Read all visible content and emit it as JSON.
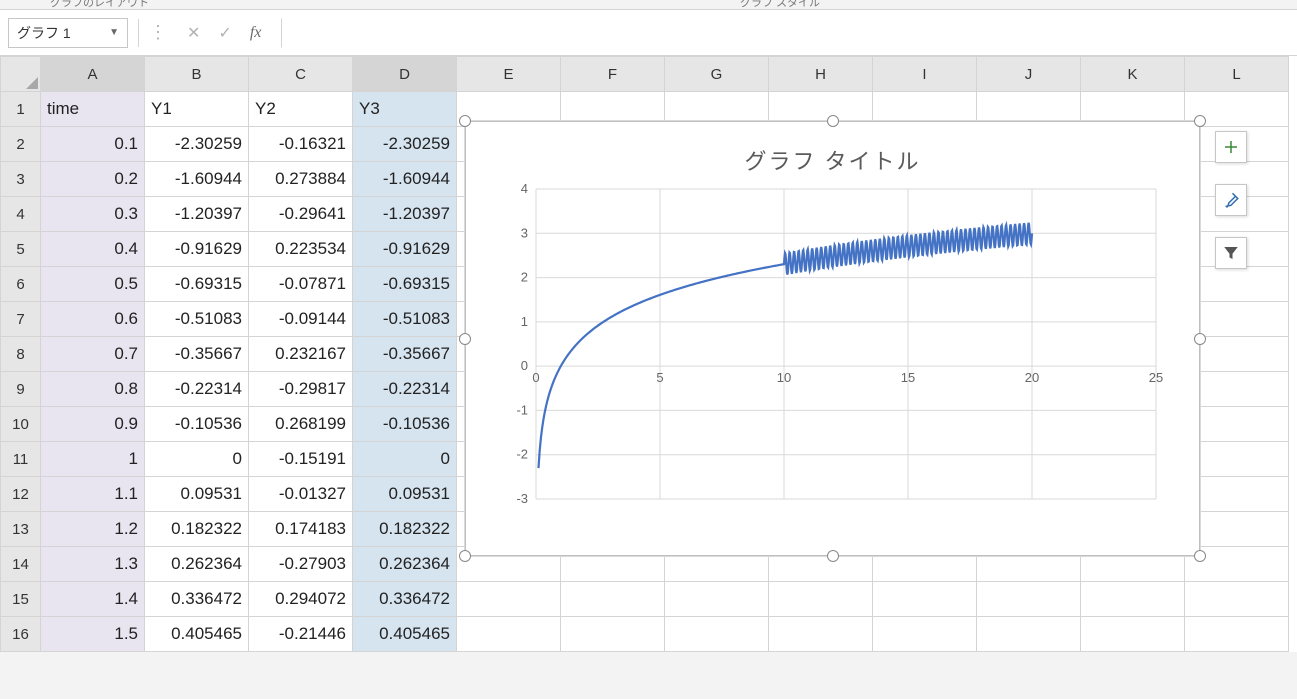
{
  "ribbon": {
    "left_group": "グラフのレイアウト",
    "right_group": "グラフ スタイル"
  },
  "namebox": {
    "value": "グラフ 1"
  },
  "formula_bar": {
    "value": ""
  },
  "columns": [
    "A",
    "B",
    "C",
    "D",
    "E",
    "F",
    "G",
    "H",
    "I",
    "J",
    "K",
    "L"
  ],
  "rows": [
    "1",
    "2",
    "3",
    "4",
    "5",
    "6",
    "7",
    "8",
    "9",
    "10",
    "11",
    "12",
    "13",
    "14",
    "15",
    "16"
  ],
  "headers": {
    "A": "time",
    "B": "Y1",
    "C": "Y2",
    "D": "Y3"
  },
  "data_rows": [
    {
      "A": "0.1",
      "B": "-2.30259",
      "C": "-0.16321",
      "D": "-2.30259"
    },
    {
      "A": "0.2",
      "B": "-1.60944",
      "C": "0.273884",
      "D": "-1.60944"
    },
    {
      "A": "0.3",
      "B": "-1.20397",
      "C": "-0.29641",
      "D": "-1.20397"
    },
    {
      "A": "0.4",
      "B": "-0.91629",
      "C": "0.223534",
      "D": "-0.91629"
    },
    {
      "A": "0.5",
      "B": "-0.69315",
      "C": "-0.07871",
      "D": "-0.69315"
    },
    {
      "A": "0.6",
      "B": "-0.51083",
      "C": "-0.09144",
      "D": "-0.51083"
    },
    {
      "A": "0.7",
      "B": "-0.35667",
      "C": "0.232167",
      "D": "-0.35667"
    },
    {
      "A": "0.8",
      "B": "-0.22314",
      "C": "-0.29817",
      "D": "-0.22314"
    },
    {
      "A": "0.9",
      "B": "-0.10536",
      "C": "0.268199",
      "D": "-0.10536"
    },
    {
      "A": "1",
      "B": "0",
      "C": "-0.15191",
      "D": "0"
    },
    {
      "A": "1.1",
      "B": "0.09531",
      "C": "-0.01327",
      "D": "0.09531"
    },
    {
      "A": "1.2",
      "B": "0.182322",
      "C": "0.174183",
      "D": "0.182322"
    },
    {
      "A": "1.3",
      "B": "0.262364",
      "C": "-0.27903",
      "D": "0.262364"
    },
    {
      "A": "1.4",
      "B": "0.336472",
      "C": "0.294072",
      "D": "0.336472"
    },
    {
      "A": "1.5",
      "B": "0.405465",
      "C": "-0.21446",
      "D": "0.405465"
    }
  ],
  "selected_columns": [
    "A",
    "D"
  ],
  "chart": {
    "title": "グラフ タイトル",
    "x_ticks": [
      "0",
      "5",
      "10",
      "15",
      "20",
      "25"
    ],
    "y_ticks": [
      "-3",
      "-2",
      "-1",
      "0",
      "1",
      "2",
      "3",
      "4"
    ]
  },
  "chart_data": {
    "type": "line",
    "title": "グラフ タイトル",
    "xlabel": "",
    "ylabel": "",
    "xlim": [
      0,
      25
    ],
    "ylim": [
      -3,
      4
    ],
    "x_ticks": [
      0,
      5,
      10,
      15,
      20,
      25
    ],
    "y_ticks": [
      -3,
      -2,
      -1,
      0,
      1,
      2,
      3,
      4
    ],
    "note": "Line follows y = ln(x) for 0 < x <= 10; for 10 < x <= 20 it oscillates rapidly around ln(x) with amplitude ~0.25. No data plotted for x > 20.",
    "series": [
      {
        "name": "Y3",
        "segment_smooth": {
          "x": [
            0.1,
            0.5,
            1,
            2,
            3,
            4,
            5,
            6,
            7,
            8,
            9,
            10
          ],
          "y": [
            -2.3,
            -0.69,
            0.0,
            0.69,
            1.1,
            1.39,
            1.61,
            1.79,
            1.95,
            2.08,
            2.2,
            2.3
          ]
        },
        "segment_oscillating": {
          "x_range": [
            10,
            20
          ],
          "baseline": "ln(x)",
          "baseline_samples": {
            "x": [
              10,
              12,
              14,
              16,
              18,
              20
            ],
            "y": [
              2.3,
              2.48,
              2.64,
              2.77,
              2.89,
              3.0
            ]
          },
          "amplitude": 0.25,
          "approx_cycles": 55
        }
      }
    ]
  },
  "side_buttons": {
    "add": "chart-elements",
    "style": "chart-styles",
    "filter": "chart-filters"
  }
}
